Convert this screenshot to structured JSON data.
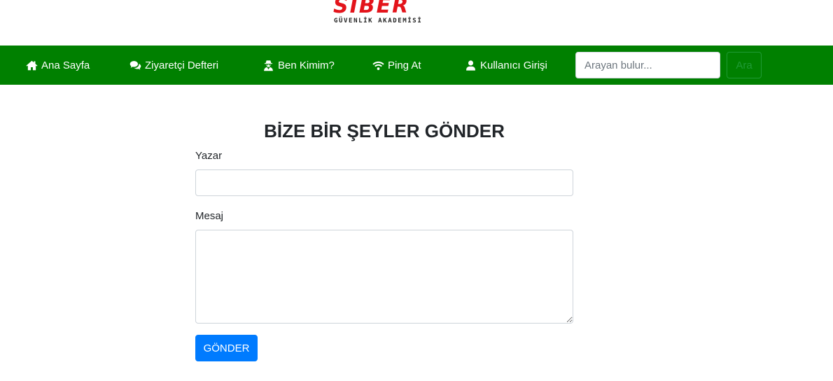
{
  "brand": {
    "name": "SİBER",
    "tagline": "GÜVENLİK AKADEMİSİ",
    "logo_color": "#e3141b"
  },
  "navbar": {
    "background_color": "#008000",
    "items": [
      {
        "label": "Ana Sayfa",
        "icon": "home-icon"
      },
      {
        "label": "Ziyaretçi Defteri",
        "icon": "comments-icon"
      },
      {
        "label": "Ben Kimim?",
        "icon": "user-secret-icon"
      },
      {
        "label": "Ping At",
        "icon": "wifi-icon"
      },
      {
        "label": "Kullanıcı Girişi",
        "icon": "user-icon"
      }
    ],
    "search": {
      "placeholder": "Arayan bulur...",
      "value": "",
      "button_label": "Ara"
    }
  },
  "form": {
    "title": "BİZE BİR ŞEYLER GÖNDER",
    "author_label": "Yazar",
    "author_value": "",
    "message_label": "Mesaj",
    "message_value": "",
    "submit_label": "GÖNDER",
    "submit_color": "#007bff"
  }
}
